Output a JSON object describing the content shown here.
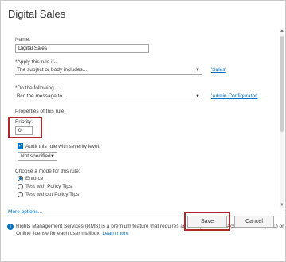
{
  "dialog": {
    "title": "Digital Sales"
  },
  "form": {
    "name_label": "Name:",
    "name_value": "Digital Sales",
    "apply_label": "*Apply this rule if...",
    "apply_select": "The subject or body includes...",
    "apply_link": "'Sales'",
    "do_label": "*Do the following...",
    "do_select": "Bcc the message to...",
    "do_link": "'Admin Configurator'",
    "properties_label": "Properties of this rule:",
    "priority_label": "Priority:",
    "priority_value": "0",
    "audit_label": "Audit this rule with severity level:",
    "audit_checked": true,
    "severity_value": "Not specified",
    "mode_label": "Choose a mode for this rule:",
    "modes": [
      {
        "label": "Enforce",
        "selected": true
      },
      {
        "label": "Test with Policy Tips",
        "selected": false
      },
      {
        "label": "Test without Policy Tips",
        "selected": false
      }
    ],
    "more_options": "More options..."
  },
  "info": {
    "line1": "Rights Management Services (RMS) is a premium feature that requires an Enterprise Client Access License (CAL) or a RMS",
    "line2": "Online license for each user mailbox.",
    "learn_more": "Learn more"
  },
  "footer": {
    "save_label": "Save",
    "cancel_label": "Cancel"
  },
  "colors": {
    "accent": "#0072c6",
    "highlight": "#b1262b"
  }
}
